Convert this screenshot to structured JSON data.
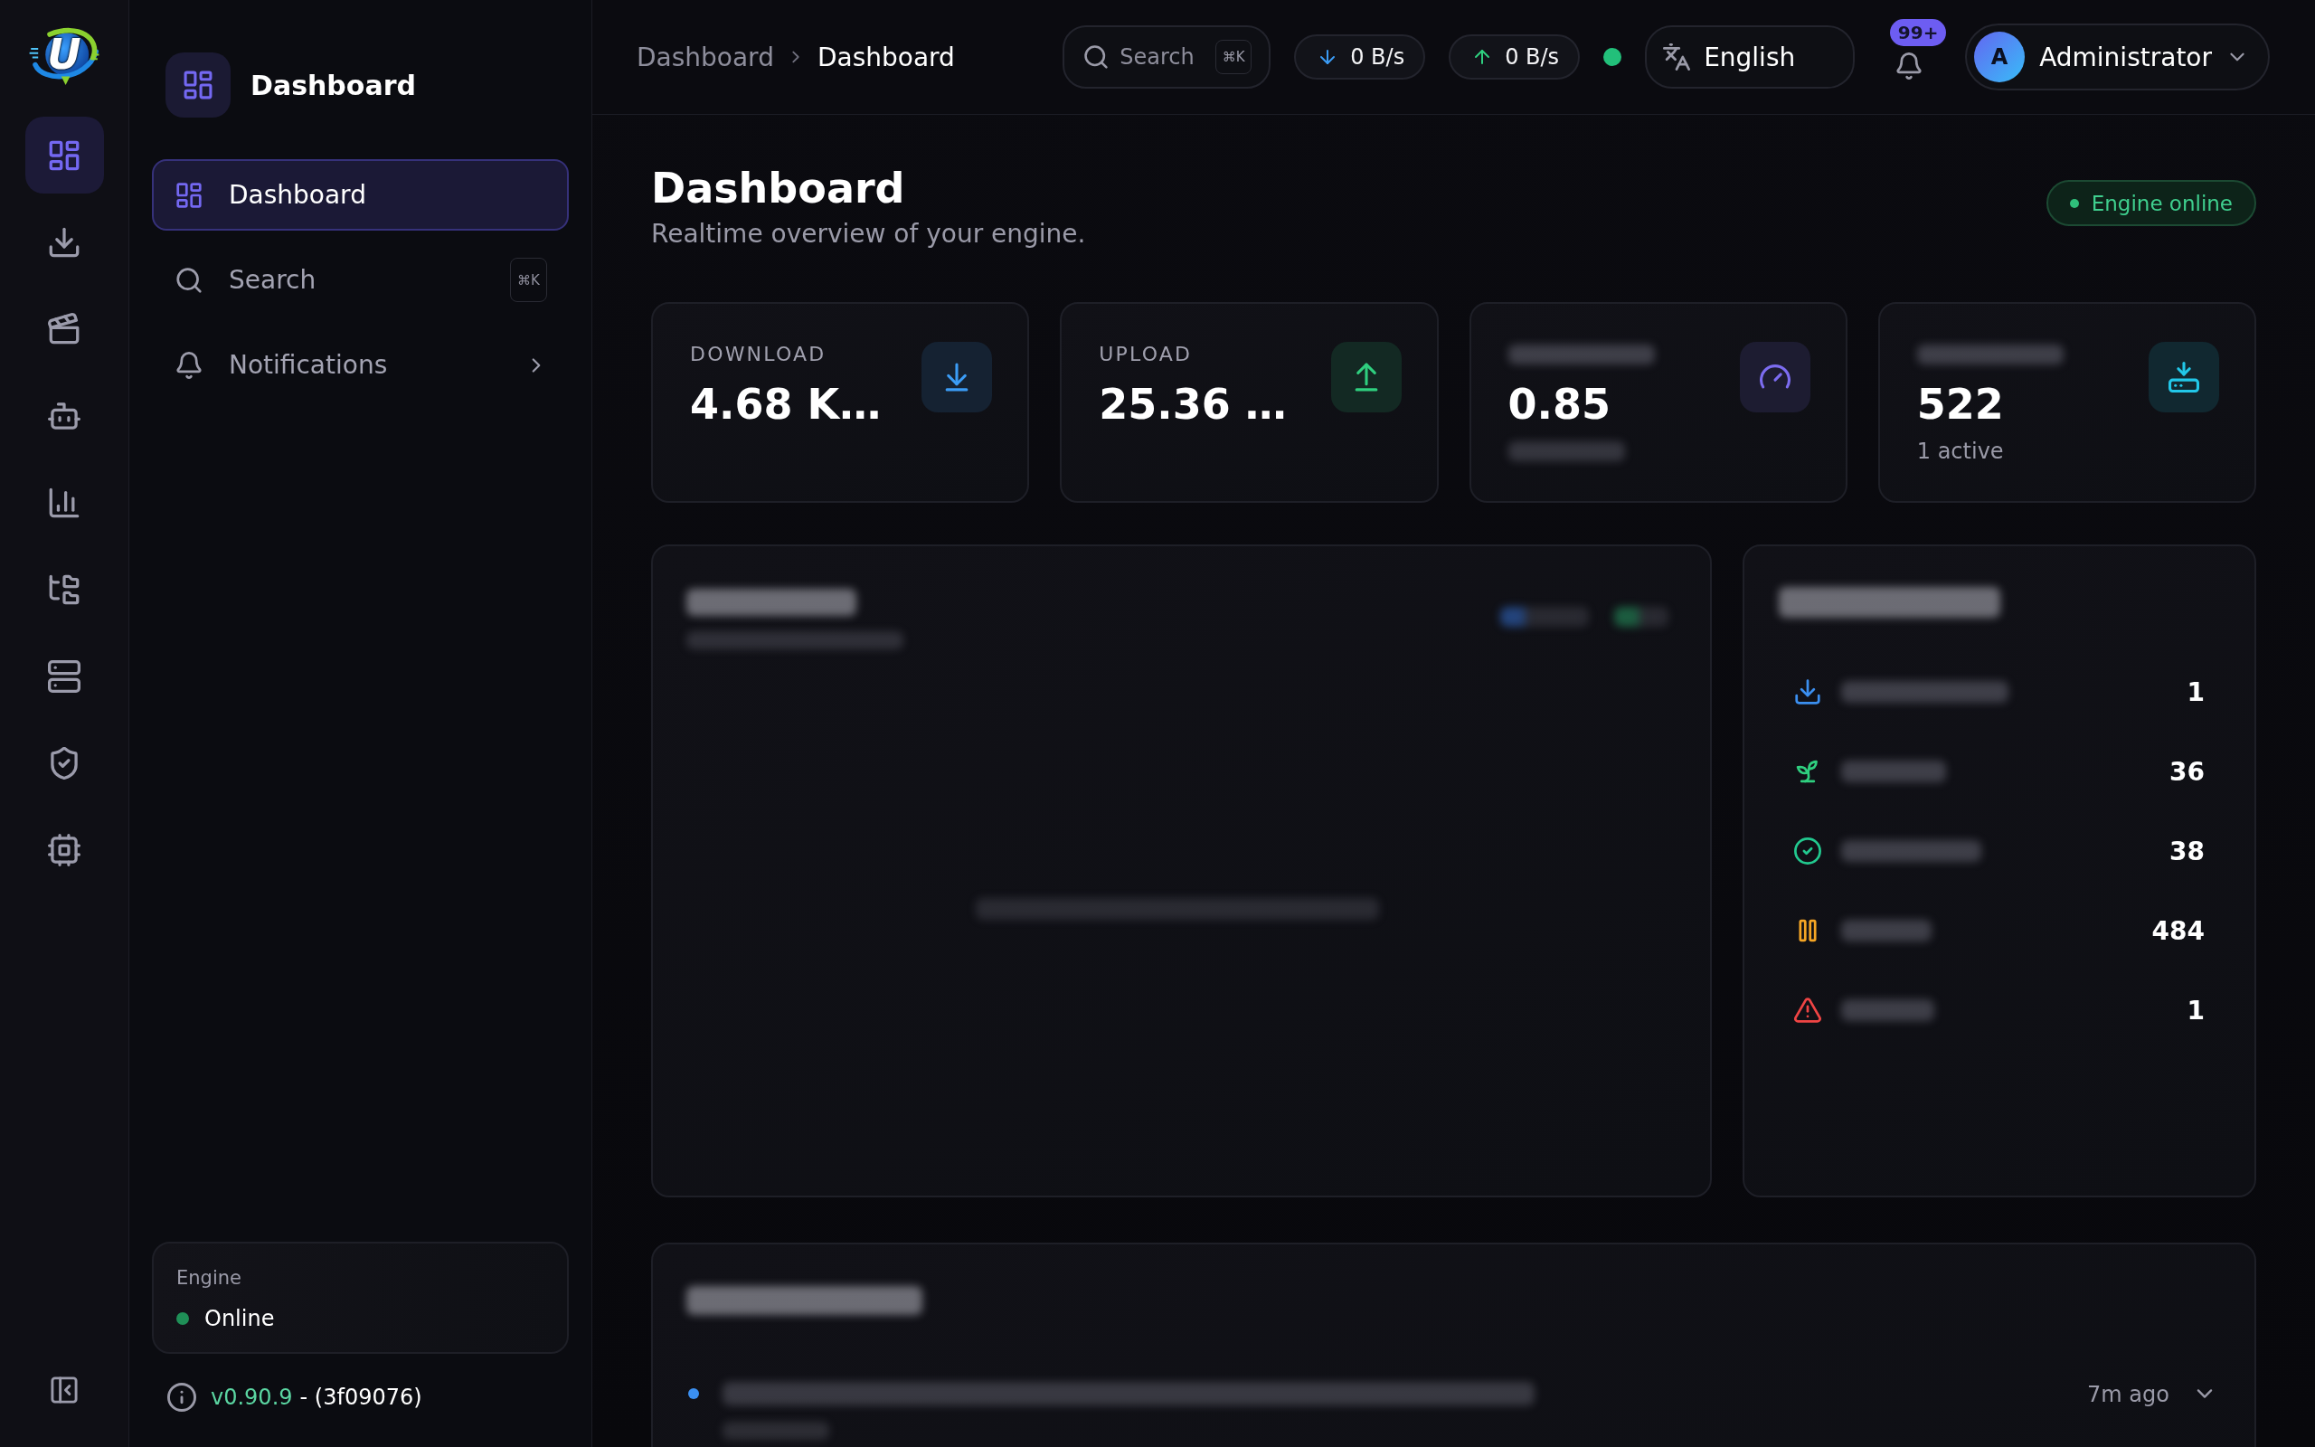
{
  "rail": {
    "logo": "U",
    "items": [
      {
        "kind": "grid",
        "selected": true
      },
      {
        "kind": "download",
        "selected": false
      },
      {
        "kind": "clapperboard",
        "selected": false
      },
      {
        "kind": "robot",
        "selected": false
      },
      {
        "kind": "chart",
        "selected": false
      },
      {
        "kind": "folder_tree",
        "selected": false
      },
      {
        "kind": "server",
        "selected": false
      },
      {
        "kind": "shield",
        "selected": false
      },
      {
        "kind": "chip",
        "selected": false
      }
    ]
  },
  "sidebar": {
    "title": "Dashboard",
    "items": [
      {
        "kind": "grid",
        "label": "Dashboard",
        "selected": true,
        "has_submenu": false
      },
      {
        "kind": "search",
        "label": "Search",
        "shortcut": "⌘K",
        "selected": false,
        "has_submenu": false
      },
      {
        "kind": "bell",
        "label": "Notifications",
        "selected": false,
        "has_submenu": true
      }
    ],
    "engine": {
      "label": "Engine",
      "status": "Online",
      "online": true
    },
    "version": {
      "number": "v0.90.9",
      "build": "- (3f09076)"
    }
  },
  "topbar": {
    "breadcrumb": [
      {
        "label": "Dashboard",
        "current": false
      },
      {
        "label": "Dashboard",
        "current": true
      }
    ],
    "search": {
      "placeholder": "Search",
      "shortcut": "⌘K"
    },
    "rates": [
      {
        "kind": "down",
        "value": "0 B/s",
        "color": "#3b9cf5"
      },
      {
        "kind": "up",
        "value": "0 B/s",
        "color": "#2fcf7f"
      }
    ],
    "connected": true,
    "language": "English",
    "notifications": {
      "badge": "99+"
    },
    "user": {
      "initial": "A",
      "name": "Administrator"
    }
  },
  "page": {
    "title": "Dashboard",
    "subtitle": "Realtime overview of your engine.",
    "status": {
      "label": "Engine online",
      "online": true
    }
  },
  "stats": [
    {
      "kind": "download",
      "label": "DOWNLOAD",
      "label_obscured": false,
      "value": "4.68 K…",
      "note_obscured": false,
      "color": "#3b9cf5"
    },
    {
      "kind": "upload",
      "label": "UPLOAD",
      "label_obscured": false,
      "value": "25.36 …",
      "note_obscured": false,
      "color": "#2fcf7f"
    },
    {
      "kind": "gauge",
      "label_obscured": true,
      "value": "0.85",
      "note_obscured": true,
      "color": "#7c6cf0"
    },
    {
      "kind": "tray",
      "label_obscured": true,
      "value": "522",
      "note": "1 active",
      "note_obscured": false,
      "color": "#22c7e8"
    }
  ],
  "torrent_status": {
    "rows": [
      {
        "kind": "downloading",
        "count": "1",
        "color": "#3b8ff0"
      },
      {
        "kind": "seeding",
        "count": "36",
        "color": "#2fcf7f"
      },
      {
        "kind": "completed",
        "count": "38",
        "color": "#22c98f"
      },
      {
        "kind": "paused",
        "count": "484",
        "color": "#f5a524"
      },
      {
        "kind": "errored",
        "count": "1",
        "color": "#ef4444"
      }
    ]
  },
  "recent_activity": {
    "rows": [
      {
        "time": "7m ago",
        "color": "#3b8ff0",
        "expanded": false
      }
    ]
  }
}
